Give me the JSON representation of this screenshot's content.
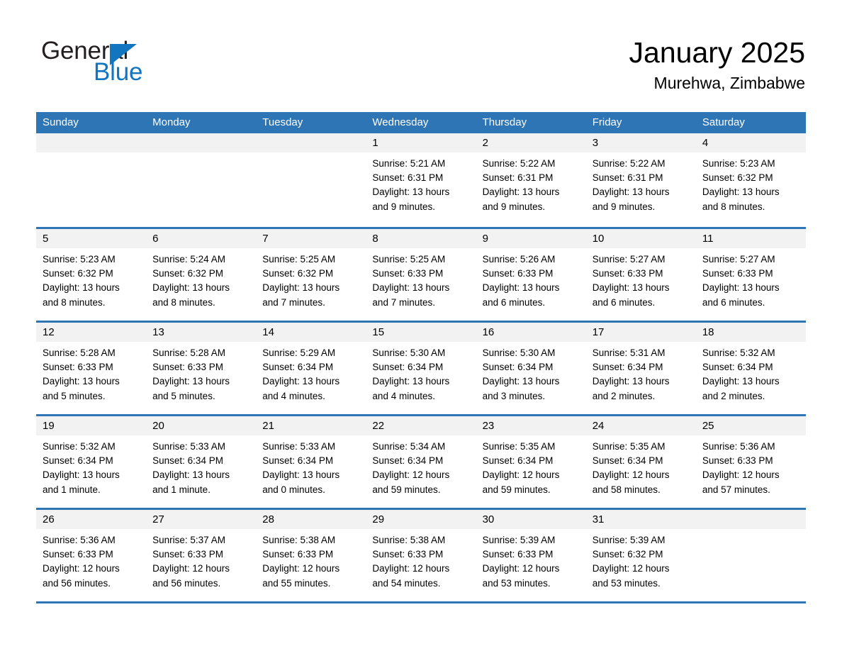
{
  "brand": {
    "name_part1": "General",
    "name_part2": "Blue",
    "accent_color": "#1175c0",
    "triangle_icon": "triangle-icon"
  },
  "header": {
    "month_title": "January 2025",
    "location": "Murehwa, Zimbabwe"
  },
  "calendar": {
    "header_color": "#2e75b6",
    "day_band_color": "#f2f2f2",
    "weekdays": [
      "Sunday",
      "Monday",
      "Tuesday",
      "Wednesday",
      "Thursday",
      "Friday",
      "Saturday"
    ],
    "weeks": [
      [
        {
          "day": "",
          "lines": []
        },
        {
          "day": "",
          "lines": []
        },
        {
          "day": "",
          "lines": []
        },
        {
          "day": "1",
          "lines": [
            "Sunrise: 5:21 AM",
            "Sunset: 6:31 PM",
            "Daylight: 13 hours",
            "and 9 minutes."
          ]
        },
        {
          "day": "2",
          "lines": [
            "Sunrise: 5:22 AM",
            "Sunset: 6:31 PM",
            "Daylight: 13 hours",
            "and 9 minutes."
          ]
        },
        {
          "day": "3",
          "lines": [
            "Sunrise: 5:22 AM",
            "Sunset: 6:31 PM",
            "Daylight: 13 hours",
            "and 9 minutes."
          ]
        },
        {
          "day": "4",
          "lines": [
            "Sunrise: 5:23 AM",
            "Sunset: 6:32 PM",
            "Daylight: 13 hours",
            "and 8 minutes."
          ]
        }
      ],
      [
        {
          "day": "5",
          "lines": [
            "Sunrise: 5:23 AM",
            "Sunset: 6:32 PM",
            "Daylight: 13 hours",
            "and 8 minutes."
          ]
        },
        {
          "day": "6",
          "lines": [
            "Sunrise: 5:24 AM",
            "Sunset: 6:32 PM",
            "Daylight: 13 hours",
            "and 8 minutes."
          ]
        },
        {
          "day": "7",
          "lines": [
            "Sunrise: 5:25 AM",
            "Sunset: 6:32 PM",
            "Daylight: 13 hours",
            "and 7 minutes."
          ]
        },
        {
          "day": "8",
          "lines": [
            "Sunrise: 5:25 AM",
            "Sunset: 6:33 PM",
            "Daylight: 13 hours",
            "and 7 minutes."
          ]
        },
        {
          "day": "9",
          "lines": [
            "Sunrise: 5:26 AM",
            "Sunset: 6:33 PM",
            "Daylight: 13 hours",
            "and 6 minutes."
          ]
        },
        {
          "day": "10",
          "lines": [
            "Sunrise: 5:27 AM",
            "Sunset: 6:33 PM",
            "Daylight: 13 hours",
            "and 6 minutes."
          ]
        },
        {
          "day": "11",
          "lines": [
            "Sunrise: 5:27 AM",
            "Sunset: 6:33 PM",
            "Daylight: 13 hours",
            "and 6 minutes."
          ]
        }
      ],
      [
        {
          "day": "12",
          "lines": [
            "Sunrise: 5:28 AM",
            "Sunset: 6:33 PM",
            "Daylight: 13 hours",
            "and 5 minutes."
          ]
        },
        {
          "day": "13",
          "lines": [
            "Sunrise: 5:28 AM",
            "Sunset: 6:33 PM",
            "Daylight: 13 hours",
            "and 5 minutes."
          ]
        },
        {
          "day": "14",
          "lines": [
            "Sunrise: 5:29 AM",
            "Sunset: 6:34 PM",
            "Daylight: 13 hours",
            "and 4 minutes."
          ]
        },
        {
          "day": "15",
          "lines": [
            "Sunrise: 5:30 AM",
            "Sunset: 6:34 PM",
            "Daylight: 13 hours",
            "and 4 minutes."
          ]
        },
        {
          "day": "16",
          "lines": [
            "Sunrise: 5:30 AM",
            "Sunset: 6:34 PM",
            "Daylight: 13 hours",
            "and 3 minutes."
          ]
        },
        {
          "day": "17",
          "lines": [
            "Sunrise: 5:31 AM",
            "Sunset: 6:34 PM",
            "Daylight: 13 hours",
            "and 2 minutes."
          ]
        },
        {
          "day": "18",
          "lines": [
            "Sunrise: 5:32 AM",
            "Sunset: 6:34 PM",
            "Daylight: 13 hours",
            "and 2 minutes."
          ]
        }
      ],
      [
        {
          "day": "19",
          "lines": [
            "Sunrise: 5:32 AM",
            "Sunset: 6:34 PM",
            "Daylight: 13 hours",
            "and 1 minute."
          ]
        },
        {
          "day": "20",
          "lines": [
            "Sunrise: 5:33 AM",
            "Sunset: 6:34 PM",
            "Daylight: 13 hours",
            "and 1 minute."
          ]
        },
        {
          "day": "21",
          "lines": [
            "Sunrise: 5:33 AM",
            "Sunset: 6:34 PM",
            "Daylight: 13 hours",
            "and 0 minutes."
          ]
        },
        {
          "day": "22",
          "lines": [
            "Sunrise: 5:34 AM",
            "Sunset: 6:34 PM",
            "Daylight: 12 hours",
            "and 59 minutes."
          ]
        },
        {
          "day": "23",
          "lines": [
            "Sunrise: 5:35 AM",
            "Sunset: 6:34 PM",
            "Daylight: 12 hours",
            "and 59 minutes."
          ]
        },
        {
          "day": "24",
          "lines": [
            "Sunrise: 5:35 AM",
            "Sunset: 6:34 PM",
            "Daylight: 12 hours",
            "and 58 minutes."
          ]
        },
        {
          "day": "25",
          "lines": [
            "Sunrise: 5:36 AM",
            "Sunset: 6:33 PM",
            "Daylight: 12 hours",
            "and 57 minutes."
          ]
        }
      ],
      [
        {
          "day": "26",
          "lines": [
            "Sunrise: 5:36 AM",
            "Sunset: 6:33 PM",
            "Daylight: 12 hours",
            "and 56 minutes."
          ]
        },
        {
          "day": "27",
          "lines": [
            "Sunrise: 5:37 AM",
            "Sunset: 6:33 PM",
            "Daylight: 12 hours",
            "and 56 minutes."
          ]
        },
        {
          "day": "28",
          "lines": [
            "Sunrise: 5:38 AM",
            "Sunset: 6:33 PM",
            "Daylight: 12 hours",
            "and 55 minutes."
          ]
        },
        {
          "day": "29",
          "lines": [
            "Sunrise: 5:38 AM",
            "Sunset: 6:33 PM",
            "Daylight: 12 hours",
            "and 54 minutes."
          ]
        },
        {
          "day": "30",
          "lines": [
            "Sunrise: 5:39 AM",
            "Sunset: 6:33 PM",
            "Daylight: 12 hours",
            "and 53 minutes."
          ]
        },
        {
          "day": "31",
          "lines": [
            "Sunrise: 5:39 AM",
            "Sunset: 6:32 PM",
            "Daylight: 12 hours",
            "and 53 minutes."
          ]
        },
        {
          "day": "",
          "lines": []
        }
      ]
    ]
  }
}
